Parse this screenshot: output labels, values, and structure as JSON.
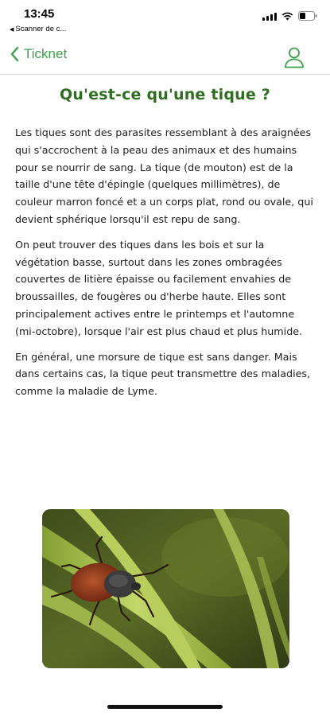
{
  "status_bar": {
    "time": "13:45",
    "back_app": "Scanner de c..."
  },
  "header": {
    "back_label": "Ticknet",
    "accent_color": "#3aa14a"
  },
  "page": {
    "title": "Qu'est-ce qu'une tique ?",
    "title_color": "#2e6f1f",
    "paragraphs": [
      "Les tiques sont des parasites ressemblant à des araignées qui s'accrochent à la peau des animaux et des humains pour se nourrir de sang. La tique (de mouton) est de la taille d'une tête d'épingle (quelques millimètres), de couleur marron foncé et a un corps plat, rond ou ovale, qui devient sphérique lorsqu'il est repu de sang.",
      "On peut trouver des tiques dans les bois et sur la végétation basse, surtout dans les zones ombragées couvertes de litière épaisse ou facilement envahies de broussailles, de fougères ou d'herbe haute. Elles sont principalement actives entre le printemps et l'automne (mi-octobre), lorsque l'air est plus chaud et plus humide.",
      "En général, une morsure de tique est sans danger. Mais dans certains cas, la tique peut transmettre des maladies, comme la maladie de Lyme."
    ]
  },
  "icons": {
    "back": "chevron-left-icon",
    "profile": "user-icon",
    "signal": "signal-icon",
    "wifi": "wifi-icon",
    "battery": "battery-icon"
  }
}
